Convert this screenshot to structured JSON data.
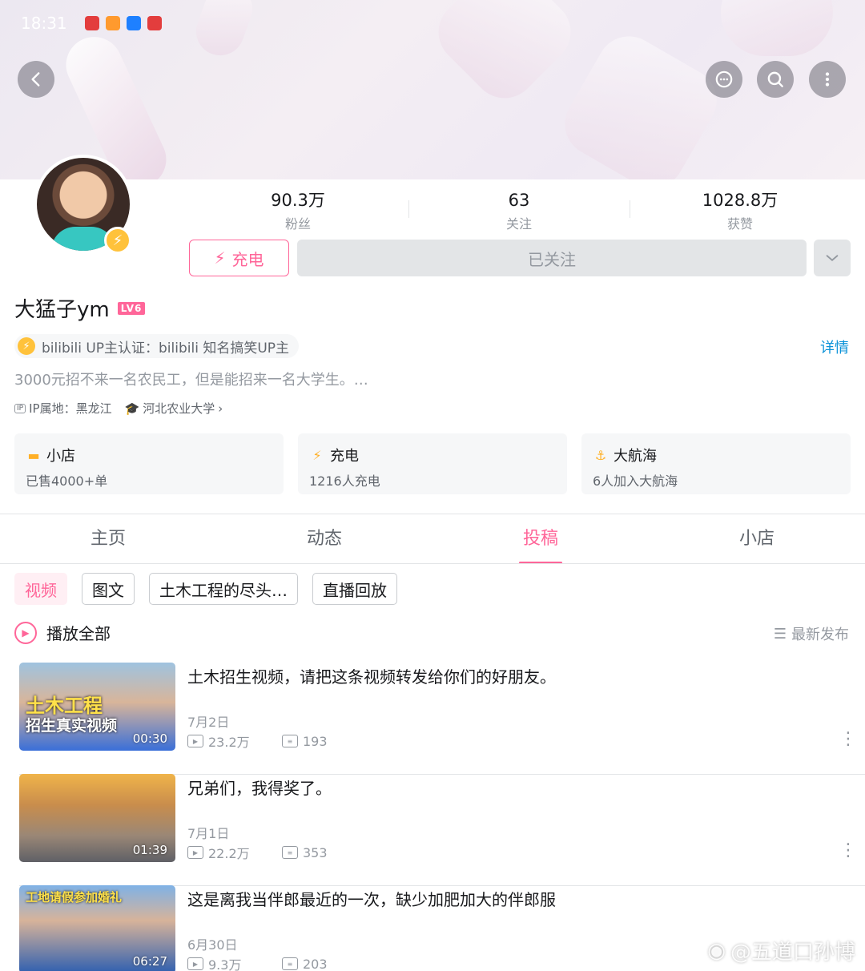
{
  "statusbar": {
    "time": "18:31",
    "right": ""
  },
  "profile": {
    "name": "大猛子ym",
    "level": "LV6",
    "stats": [
      {
        "num": "90.3万",
        "label": "粉丝"
      },
      {
        "num": "63",
        "label": "关注"
      },
      {
        "num": "1028.8万",
        "label": "获赞"
      }
    ],
    "charge_label": "充电",
    "follow_label": "已关注",
    "cert_text": "bilibili UP主认证：bilibili 知名搞笑UP主",
    "detail_label": "详情",
    "sign": "3000元招不来一名农民工，但是能招来一名大学生。…",
    "ip_badge": "IP",
    "ip": "IP属地：黑龙江",
    "school": "河北农业大学"
  },
  "cards": [
    {
      "title": "小店",
      "sub": "已售4000+单",
      "icon": "shop-icon",
      "color": "#ffb027"
    },
    {
      "title": "充电",
      "sub": "1216人充电",
      "icon": "bolt-icon",
      "color": "#ffb027"
    },
    {
      "title": "大航海",
      "sub": "6人加入大航海",
      "icon": "anchor-icon",
      "color": "#ffb027"
    }
  ],
  "tabs": [
    {
      "label": "主页"
    },
    {
      "label": "动态"
    },
    {
      "label": "投稿"
    },
    {
      "label": "小店"
    }
  ],
  "active_tab": "投稿",
  "filters": [
    {
      "label": "视频"
    },
    {
      "label": "图文"
    },
    {
      "label": "土木工程的尽头…"
    },
    {
      "label": "直播回放"
    }
  ],
  "play_all_label": "播放全部",
  "sort_label": "最新发布",
  "videos": [
    {
      "title": "土木招生视频，请把这条视频转发给你们的好朋友。",
      "date": "7月2日",
      "views": "23.2万",
      "comments": "193",
      "duration": "00:30",
      "caption1": "土木工程",
      "caption2": "招生真实视频"
    },
    {
      "title": "兄弟们，我得奖了。",
      "date": "7月1日",
      "views": "22.2万",
      "comments": "353",
      "duration": "01:39",
      "caption1": "",
      "caption2": ""
    },
    {
      "title": "这是离我当伴郎最近的一次，缺少加肥加大的伴郎服",
      "date": "6月30日",
      "views": "9.3万",
      "comments": "203",
      "duration": "06:27",
      "caption1": "工地请假参加婚礼",
      "caption2": ""
    }
  ],
  "watermark": "@五道口孙博",
  "colors": {
    "accent": "#ff6699",
    "link": "#0a92d8",
    "gold": "#ffc23b"
  }
}
